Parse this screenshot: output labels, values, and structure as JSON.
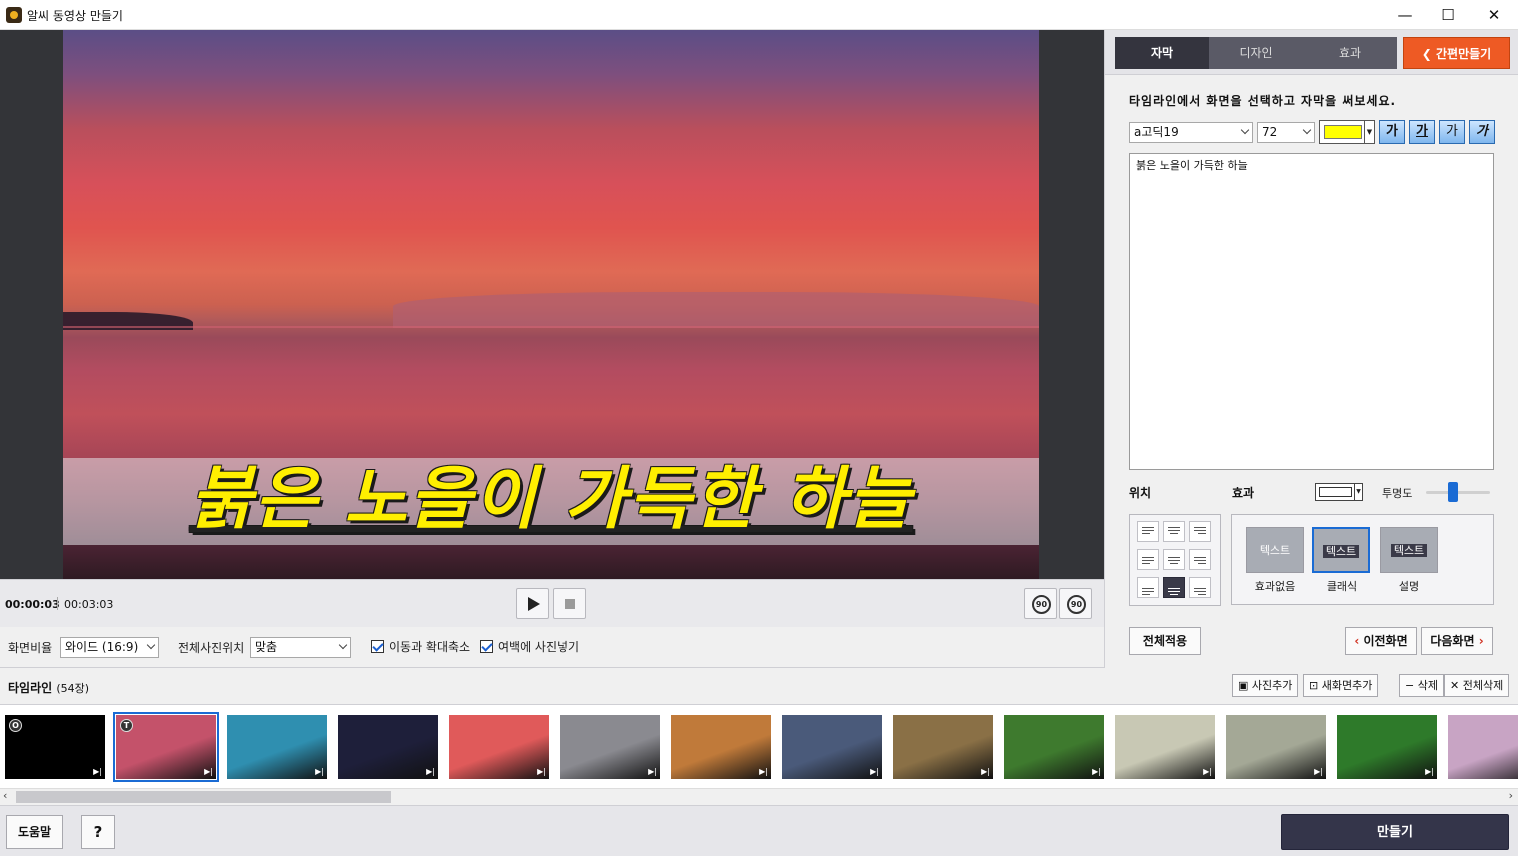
{
  "window": {
    "title": "알씨 동영상 만들기",
    "minimize": "—",
    "maximize": "☐",
    "close": "✕"
  },
  "preview": {
    "caption": "붉은 노을이 가득한 하늘"
  },
  "playback": {
    "current_time": "00:00:03",
    "total_time": "00:03:03",
    "rotate_left_label": "90",
    "rotate_right_label": "90"
  },
  "options": {
    "aspect_label": "화면비율",
    "aspect_value": "와이드 (16:9)",
    "photo_position_label": "전체사진위치",
    "photo_position_value": "맞춤",
    "pan_zoom_label": "이동과 확대축소",
    "pan_zoom_checked": true,
    "fill_margin_label": "여백에 사진넣기",
    "fill_margin_checked": true
  },
  "panel": {
    "tabs": [
      "자막",
      "디자인",
      "효과"
    ],
    "active_tab": "자막",
    "quick_make_label": "간편만들기",
    "instruction": "타임라인에서 화면을 선택하고 자막을 써보세요.",
    "font_value": "a고딕19",
    "size_value": "72",
    "text_color": "#ffff00",
    "style_buttons": [
      "가",
      "가",
      "가",
      "가"
    ],
    "subtitle_text": "붉은 노을이 가득한 하늘",
    "position_label": "위치",
    "effect_label": "효과",
    "opacity_label": "투명도",
    "opacity_level": 0.4,
    "effects": [
      {
        "preview_text": "텍스트",
        "name": "효과없음"
      },
      {
        "preview_text": "텍스트",
        "name": "클래식"
      },
      {
        "preview_text": "텍스트",
        "name": "설명"
      }
    ],
    "selected_effect": "클래식",
    "apply_all_label": "전체적용",
    "prev_label": "이전화면",
    "next_label": "다음화면"
  },
  "timeline": {
    "title": "타임라인",
    "count": "(54장)",
    "add_photo_label": "사진추가",
    "add_screen_label": "새화면추가",
    "delete_label": "삭제",
    "delete_all_label": "전체삭제",
    "thumb_badges": [
      "O",
      "T"
    ],
    "thumb_colors": [
      "#000000",
      "#c4526a",
      "#2f8fb0",
      "#1e1f3a",
      "#e05a5a",
      "#8a8a90",
      "#c07a3a",
      "#4a5a7a",
      "#8a7046",
      "#3e7a2e",
      "#c8c8b4",
      "#a4a896",
      "#2e7a2a",
      "#c8a4c4"
    ]
  },
  "bottom": {
    "help_label": "도움말",
    "question_label": "?",
    "make_label": "만들기"
  }
}
